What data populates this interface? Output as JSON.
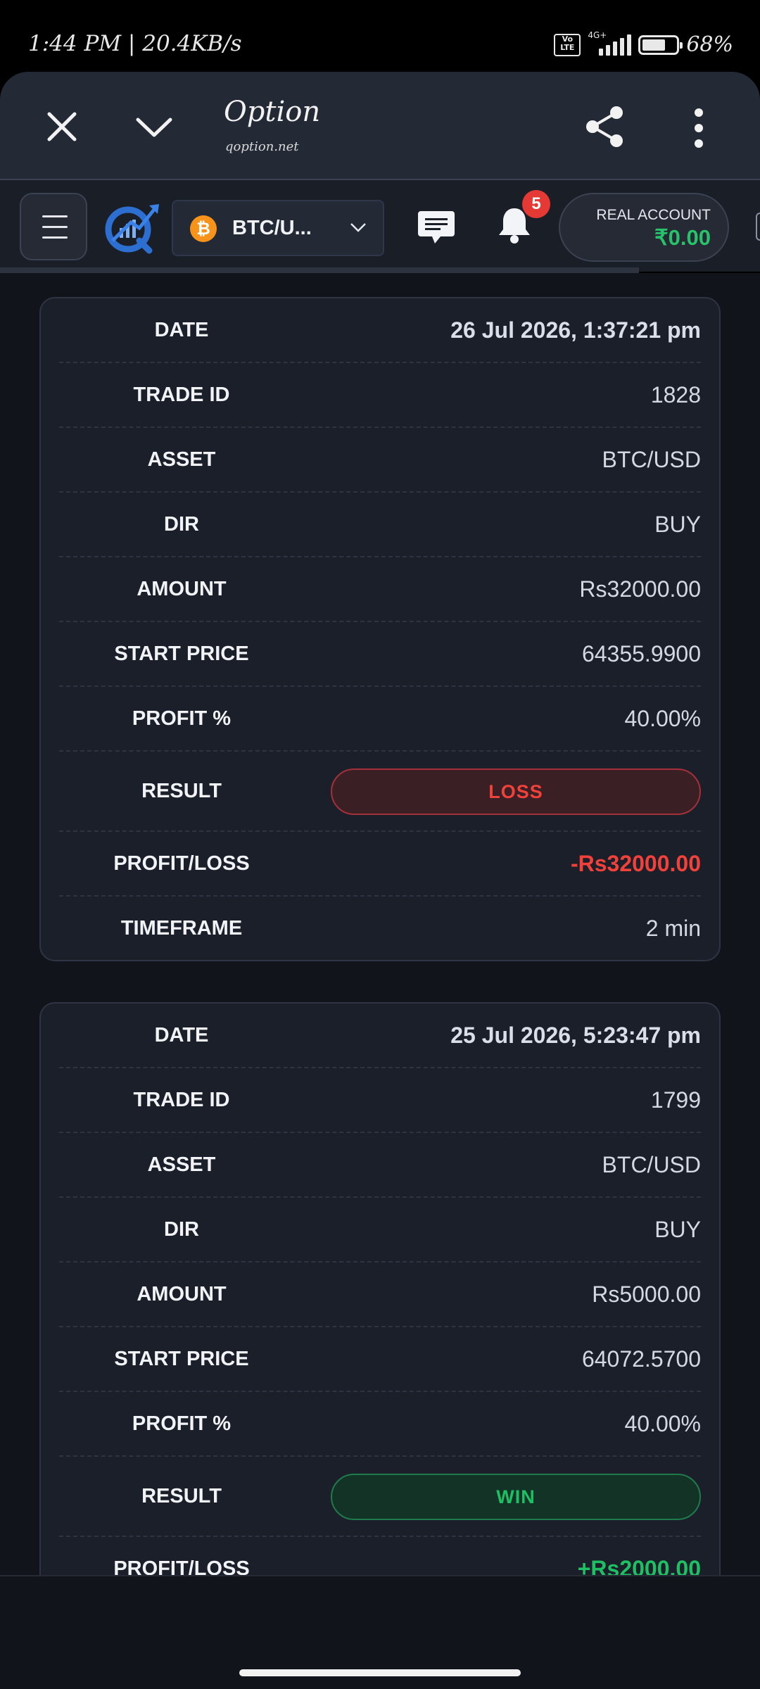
{
  "status_bar": {
    "time_speed": "1:44 PM | 20.4KB/s",
    "volte": "Vo LTE",
    "network": "4G+",
    "battery_pct": "68%",
    "battery_level": 0.68
  },
  "browser": {
    "title": "Option",
    "url": "qoption.net"
  },
  "app_header": {
    "asset": "BTC/U...",
    "asset_coin_symbol": "₿",
    "notification_count": "5",
    "account_label": "REAL ACCOUNT",
    "account_balance": "₹0.00"
  },
  "trades": [
    {
      "date_label": "DATE",
      "date": "26 Jul 2026, 1:37:21 pm",
      "trade_id_label": "TRADE ID",
      "trade_id": "1828",
      "asset_label": "ASSET",
      "asset": "BTC/USD",
      "dir_label": "DIR",
      "dir": "BUY",
      "amount_label": "AMOUNT",
      "amount": "Rs32000.00",
      "start_price_label": "START PRICE",
      "start_price": "64355.9900",
      "profit_pct_label": "PROFIT %",
      "profit_pct": "40.00%",
      "result_label": "RESULT",
      "result": "LOSS",
      "pl_label": "PROFIT/LOSS",
      "pl": "-Rs32000.00",
      "timeframe_label": "TIMEFRAME",
      "timeframe": "2 min"
    },
    {
      "date_label": "DATE",
      "date": "25 Jul 2026, 5:23:47 pm",
      "trade_id_label": "TRADE ID",
      "trade_id": "1799",
      "asset_label": "ASSET",
      "asset": "BTC/USD",
      "dir_label": "DIR",
      "dir": "BUY",
      "amount_label": "AMOUNT",
      "amount": "Rs5000.00",
      "start_price_label": "START PRICE",
      "start_price": "64072.5700",
      "profit_pct_label": "PROFIT %",
      "profit_pct": "40.00%",
      "result_label": "RESULT",
      "result": "WIN",
      "pl_label": "PROFIT/LOSS",
      "pl": "+Rs2000.00"
    }
  ],
  "colors": {
    "loss": "#f0413a",
    "win": "#1fbf63",
    "balance": "#27c26a",
    "badge": "#e53935"
  }
}
